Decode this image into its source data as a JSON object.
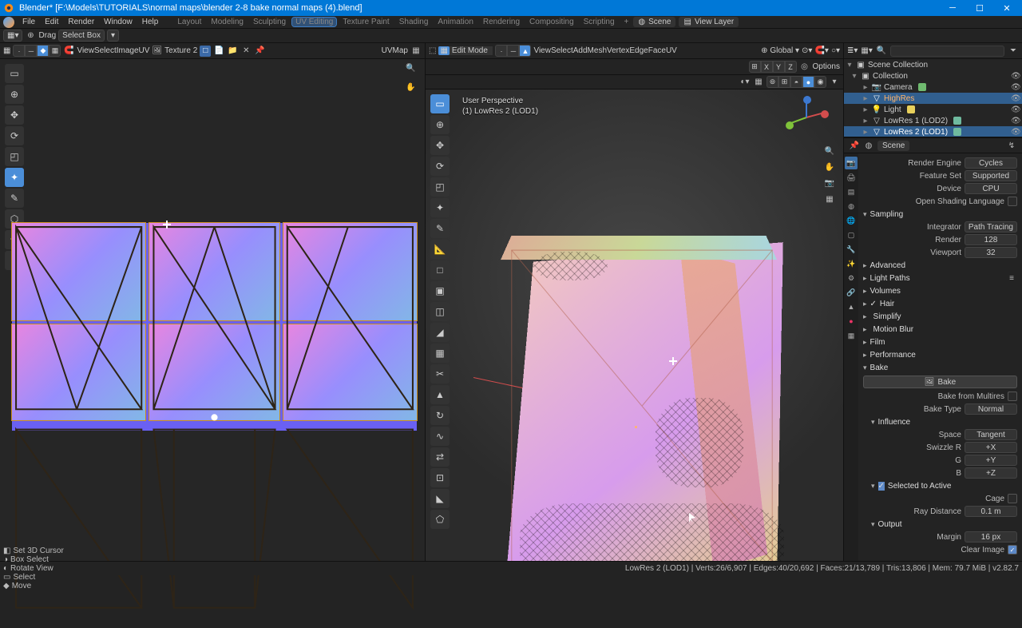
{
  "title": "Blender* [F:\\Models\\TUTORIALS\\normal maps\\blender 2-8 bake normal maps (4).blend]",
  "info": {
    "scene_label": "Scene",
    "viewlayer_label": "View Layer"
  },
  "menu": {
    "items": [
      "File",
      "Edit",
      "Render",
      "Window",
      "Help"
    ],
    "tabs": [
      "Layout",
      "Modeling",
      "Sculpting",
      "UV Editing",
      "Texture Paint",
      "Shading",
      "Animation",
      "Rendering",
      "Compositing",
      "Scripting",
      "+"
    ],
    "active_tab": "UV Editing"
  },
  "uv": {
    "drag_label": "Drag",
    "select_mode": "Select Box",
    "sub_menu": [
      "View",
      "Select",
      "Image",
      "UV"
    ],
    "image_name": "Texture 2",
    "uvmap_name": "UVMap"
  },
  "vp": {
    "mode": "Edit Mode",
    "menus": [
      "View",
      "Select",
      "Add",
      "Mesh",
      "Vertex",
      "Edge",
      "Face",
      "UV"
    ],
    "orient": "Global",
    "options": "Options",
    "info_line1": "User Perspective",
    "info_line2": "(1) LowRes 2 (LOD1)"
  },
  "outliner": {
    "header": "Scene Collection",
    "items": [
      {
        "depth": 0,
        "icon": "col",
        "label": "Collection"
      },
      {
        "depth": 1,
        "icon": "cam",
        "label": "Camera",
        "dot": "#6fba6f"
      },
      {
        "depth": 1,
        "icon": "mesh",
        "label": "HighRes",
        "sel": true,
        "color": "#ffb36b"
      },
      {
        "depth": 1,
        "icon": "light",
        "label": "Light",
        "dot": "#e8d05b"
      },
      {
        "depth": 1,
        "icon": "mesh",
        "label": "LowRes 1 (LOD2)",
        "dot": "#6fba9f"
      },
      {
        "depth": 1,
        "icon": "mesh",
        "label": "LowRes 2 (LOD1)",
        "sel": true,
        "dot": "#6fba9f"
      }
    ]
  },
  "scene_header": {
    "label": "Scene"
  },
  "props": {
    "render_engine": {
      "label": "Render Engine",
      "value": "Cycles"
    },
    "feature_set": {
      "label": "Feature Set",
      "value": "Supported"
    },
    "device": {
      "label": "Device",
      "value": "CPU"
    },
    "osl": {
      "label": "Open Shading Language"
    },
    "sampling": {
      "header": "Sampling",
      "integrator": {
        "label": "Integrator",
        "value": "Path Tracing"
      },
      "render": {
        "label": "Render",
        "value": "128"
      },
      "viewport": {
        "label": "Viewport",
        "value": "32"
      }
    },
    "panels_closed": [
      "Advanced",
      "Light Paths",
      "Volumes"
    ],
    "hair": {
      "label": "Hair"
    },
    "simplify": {
      "label": "Simplify"
    },
    "motion_blur": {
      "label": "Motion Blur"
    },
    "film": {
      "label": "Film"
    },
    "performance": {
      "label": "Performance"
    },
    "bake": {
      "header": "Bake",
      "button": "Bake",
      "from_multires": "Bake from Multires",
      "type": {
        "label": "Bake Type",
        "value": "Normal"
      },
      "influence": "Influence",
      "space": {
        "label": "Space",
        "value": "Tangent"
      },
      "swizzle_r": {
        "label": "Swizzle R",
        "value": "+X"
      },
      "swizzle_g": {
        "label": "G",
        "value": "+Y"
      },
      "swizzle_b": {
        "label": "B",
        "value": "+Z"
      },
      "sel_to_active": "Selected to Active",
      "cage": "Cage",
      "ray_dist": {
        "label": "Ray Distance",
        "value": "0.1 m"
      },
      "output": "Output",
      "margin": {
        "label": "Margin",
        "value": "16 px"
      },
      "clear": "Clear Image"
    }
  },
  "status": {
    "left": [
      {
        "icon": "◧",
        "text": "Set 3D Cursor"
      },
      {
        "icon": "◑",
        "text": "Box Select"
      },
      {
        "icon": "◐",
        "text": "Rotate View"
      },
      {
        "icon": "▭",
        "text": "Select"
      },
      {
        "icon": "◆",
        "text": "Move"
      }
    ],
    "stats": "LowRes 2 (LOD1)  |  Verts:26/6,907  |  Edges:40/20,692  |  Faces:21/13,789  |  Tris:13,806  |  Mem: 79.7 MiB  |  v2.82.7"
  },
  "colors": {
    "axis_x": "#d24d4d",
    "axis_y": "#7fc23a",
    "axis_z": "#3c78d0"
  }
}
